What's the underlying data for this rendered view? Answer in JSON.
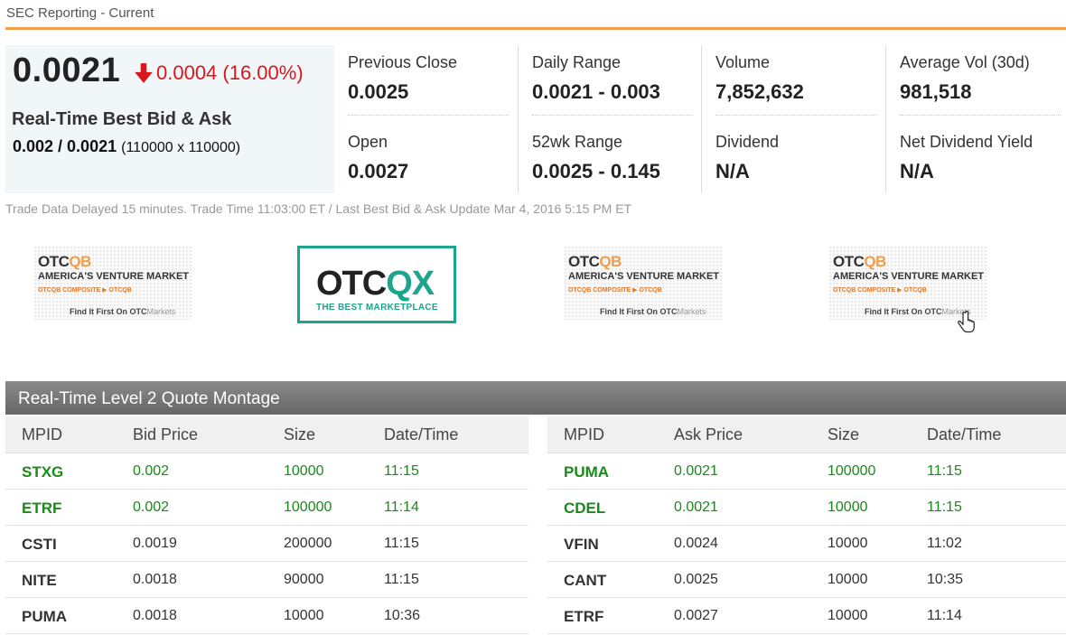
{
  "breadcrumb": "SEC Reporting - Current",
  "quote": {
    "price": "0.0021",
    "change": "0.0004 (16.00%)",
    "bid_ask_title": "Real-Time Best Bid & Ask",
    "bid_ask_value": "0.002 / 0.0021",
    "bid_ask_sizes": "(110000 x 110000)"
  },
  "stats": [
    {
      "label": "Previous Close",
      "value": "0.0025"
    },
    {
      "label": "Daily Range",
      "value": "0.0021 - 0.003"
    },
    {
      "label": "Volume",
      "value": "7,852,632"
    },
    {
      "label": "Average Vol (30d)",
      "value": "981,518"
    },
    {
      "label": "Open",
      "value": "0.0027"
    },
    {
      "label": "52wk Range",
      "value": "0.0025 - 0.145"
    },
    {
      "label": "Dividend",
      "value": "N/A"
    },
    {
      "label": "Net Dividend Yield",
      "value": "N/A"
    }
  ],
  "delayed_note": "Trade Data Delayed 15 minutes. Trade Time 11:03:00 ET / Last Best Bid & Ask Update Mar 4, 2016 5:15 PM ET",
  "ads": {
    "otcqb_logo_a": "OTC",
    "otcqb_logo_b": "QB",
    "otcqb_tag": "AMERICA'S VENTURE MARKET",
    "otcqb_sub": "OTCQB COMPOSITE ▶ OTCQB",
    "otcqb_find": "Find It First On OTC",
    "otcqb_markets": "Markets",
    "otcqx_logo_a": "OTC",
    "otcqx_logo_b": "QX",
    "otcqx_tag": "THE BEST MARKETPLACE"
  },
  "montage": {
    "title": "Real-Time Level 2 Quote Montage",
    "bid": {
      "headers": [
        "MPID",
        "Bid Price",
        "Size",
        "Date/Time"
      ],
      "rows": [
        {
          "mpid": "STXG",
          "price": "0.002",
          "size": "10000",
          "time": "11:15",
          "best": true
        },
        {
          "mpid": "ETRF",
          "price": "0.002",
          "size": "100000",
          "time": "11:14",
          "best": true
        },
        {
          "mpid": "CSTI",
          "price": "0.0019",
          "size": "200000",
          "time": "11:15",
          "best": false
        },
        {
          "mpid": "NITE",
          "price": "0.0018",
          "size": "90000",
          "time": "11:15",
          "best": false
        },
        {
          "mpid": "PUMA",
          "price": "0.0018",
          "size": "10000",
          "time": "10:36",
          "best": false
        }
      ]
    },
    "ask": {
      "headers": [
        "MPID",
        "Ask Price",
        "Size",
        "Date/Time"
      ],
      "rows": [
        {
          "mpid": "PUMA",
          "price": "0.0021",
          "size": "100000",
          "time": "11:15",
          "best": true
        },
        {
          "mpid": "CDEL",
          "price": "0.0021",
          "size": "10000",
          "time": "11:15",
          "best": true
        },
        {
          "mpid": "VFIN",
          "price": "0.0024",
          "size": "10000",
          "time": "11:02",
          "best": false
        },
        {
          "mpid": "CANT",
          "price": "0.0025",
          "size": "10000",
          "time": "10:35",
          "best": false
        },
        {
          "mpid": "ETRF",
          "price": "0.0027",
          "size": "10000",
          "time": "11:14",
          "best": false
        }
      ]
    }
  },
  "colors": {
    "accent_orange": "#f39c4a",
    "down_red": "#d9161c",
    "best_green": "#1a8a1a",
    "otcqx_teal": "#1aa58c"
  }
}
